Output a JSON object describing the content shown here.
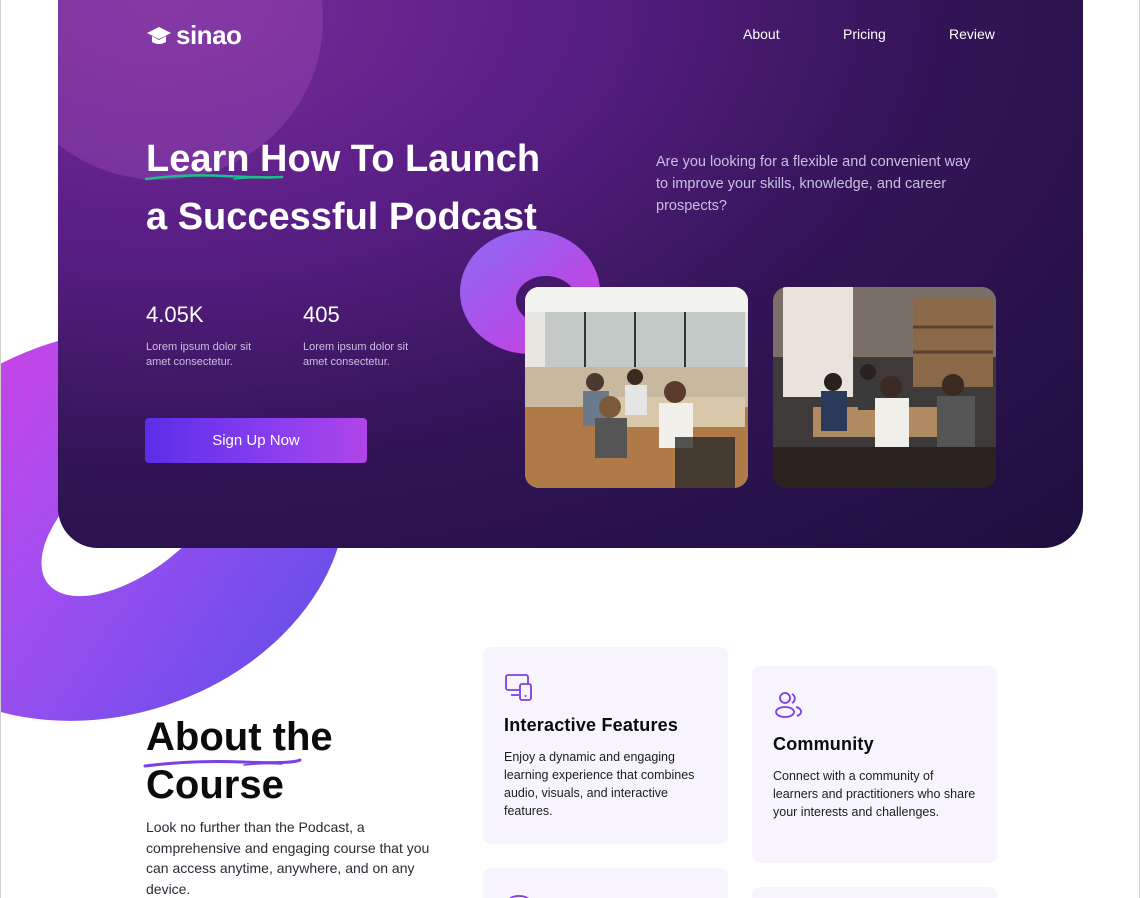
{
  "brand": {
    "name": "sinao",
    "logo_icon": "graduation-cap-icon"
  },
  "nav": {
    "items": [
      "About",
      "Pricing",
      "Review"
    ]
  },
  "hero": {
    "headline_line1": "Learn How To Launch",
    "headline_line2": "a Successful Podcast",
    "intro": "Are you looking for a flexible and convenient way to improve your skills, knowledge, and career prospects?",
    "stats": [
      {
        "value": "4.05K",
        "desc": "Lorem ipsum dolor sit amet consectetur."
      },
      {
        "value": "405",
        "desc": "Lorem ipsum dolor sit amet consectetur."
      }
    ],
    "cta_label": "Sign Up Now"
  },
  "about": {
    "title_line1": "About the",
    "title_line2": "Course",
    "text": "Look no further than the Podcast, a comprehensive and engaging course that you can access anytime, anywhere, and on any device."
  },
  "features": [
    {
      "icon": "devices-icon",
      "title": "Interactive Features",
      "text": "Enjoy a dynamic and engaging learning experience that combines audio, visuals, and interactive features."
    },
    {
      "icon": "users-icon",
      "title": "Community",
      "text": "Connect with a community of learners and practitioners who share your interests and challenges."
    }
  ],
  "colors": {
    "accent": "#7b3fe4",
    "hero_dark": "#1d0f3e",
    "hero_purple": "#6a2791",
    "underline_green": "#19c28a",
    "card_bg": "#f7f4fd"
  }
}
